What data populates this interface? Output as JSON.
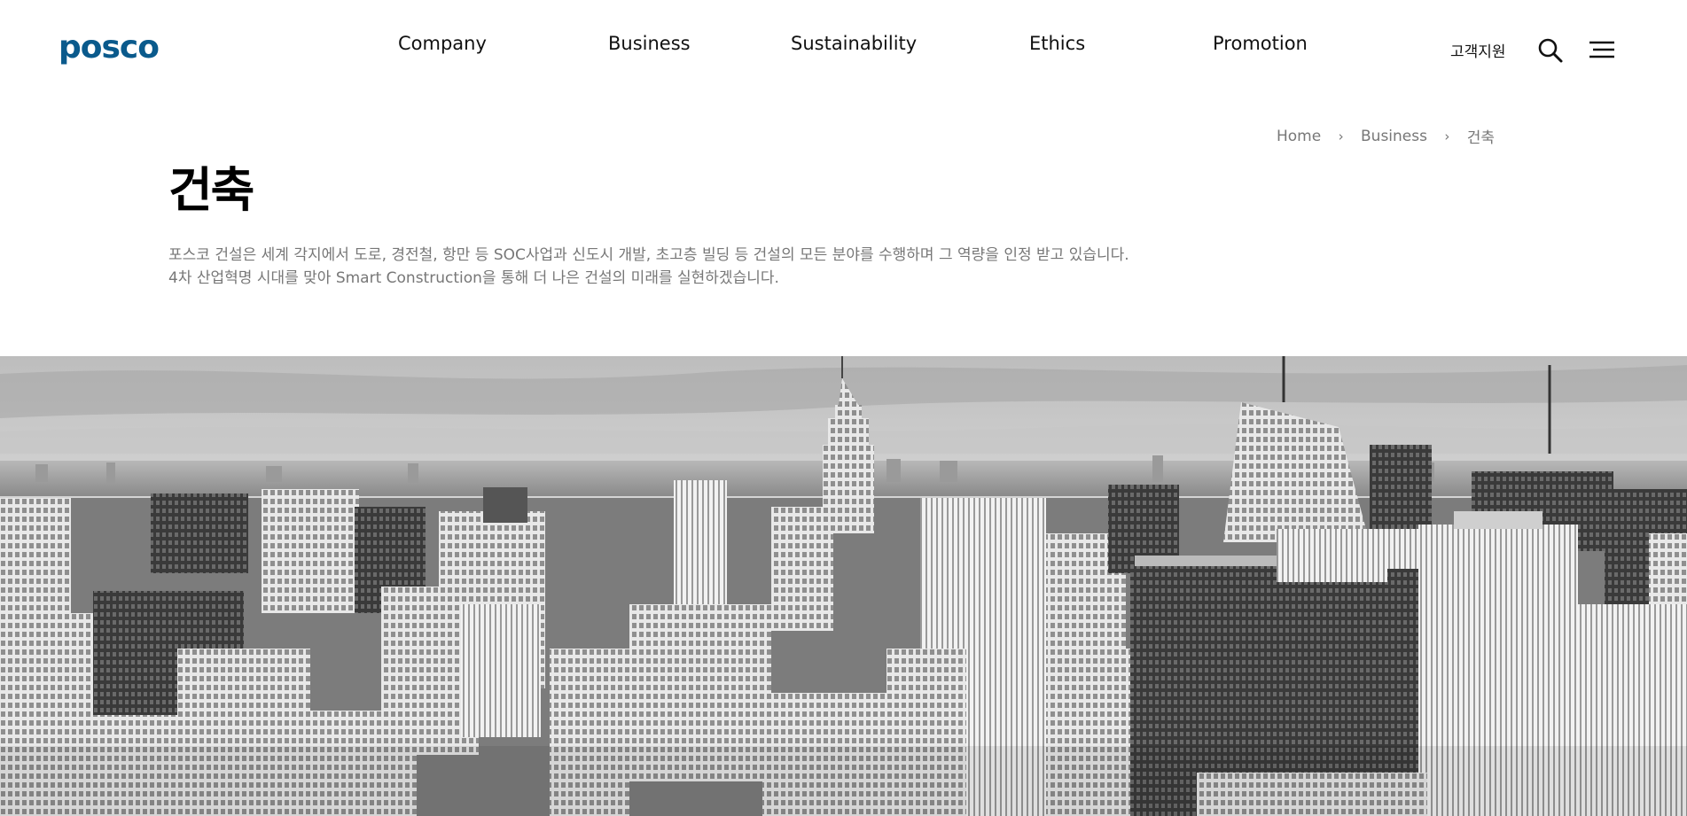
{
  "header": {
    "logo": "posco",
    "nav": [
      "Company",
      "Business",
      "Sustainability",
      "Ethics",
      "Promotion"
    ],
    "support": "고객지원",
    "search_icon": "search-icon",
    "menu_icon": "hamburger-menu-icon"
  },
  "breadcrumb": {
    "items": [
      "Home",
      "Business",
      "건축"
    ],
    "separator_icon": "chevron-right-icon"
  },
  "page": {
    "title": "건축",
    "description_lines": [
      "포스코 건설은 세계 각지에서 도로, 경전철, 항만 등 SOC사업과 신도시 개발, 초고층 빌딩 등 건설의 모든 분야를 수행하며 그 역량을 인정 받고 있습니다.",
      "4차 산업혁명 시대를 맞아 Smart Construction을 통해 더 나은 건설의 미래를 실현하겠습니다."
    ]
  },
  "colors": {
    "brand": "#0a5a8c",
    "text": "#111111",
    "muted": "#777777"
  },
  "hero": {
    "image": "black-and-white city skyline"
  }
}
